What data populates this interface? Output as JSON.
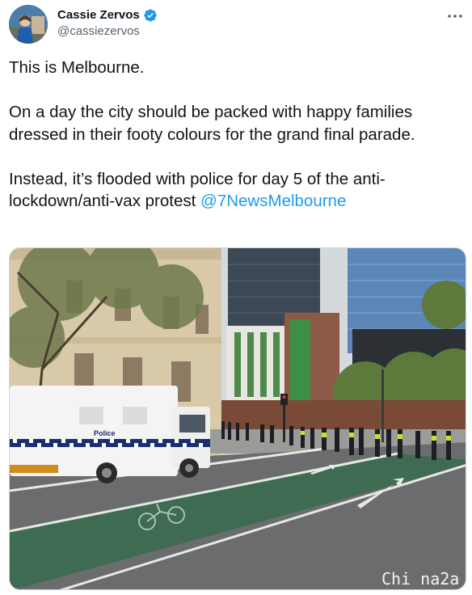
{
  "author": {
    "display_name": "Cassie Zervos",
    "handle": "@cassiezervos"
  },
  "icons": {
    "verified": "verified-badge-icon",
    "more": "more-options-icon"
  },
  "colors": {
    "link": "#1d9bf0",
    "verified": "#1d9bf0",
    "text": "#0f1419",
    "secondary": "#536471"
  },
  "tweet": {
    "line1": "This is Melbourne.",
    "line2": "On a day the city should be packed with happy families dressed in their footy colours for the grand final parade.",
    "line3": "Instead, it’s flooded with police for day 5 of the anti-lockdown/anti-vax protest",
    "mention": "@7NewsMelbourne"
  },
  "photo": {
    "van_label": "Police",
    "watermark": "Chi na2a"
  }
}
